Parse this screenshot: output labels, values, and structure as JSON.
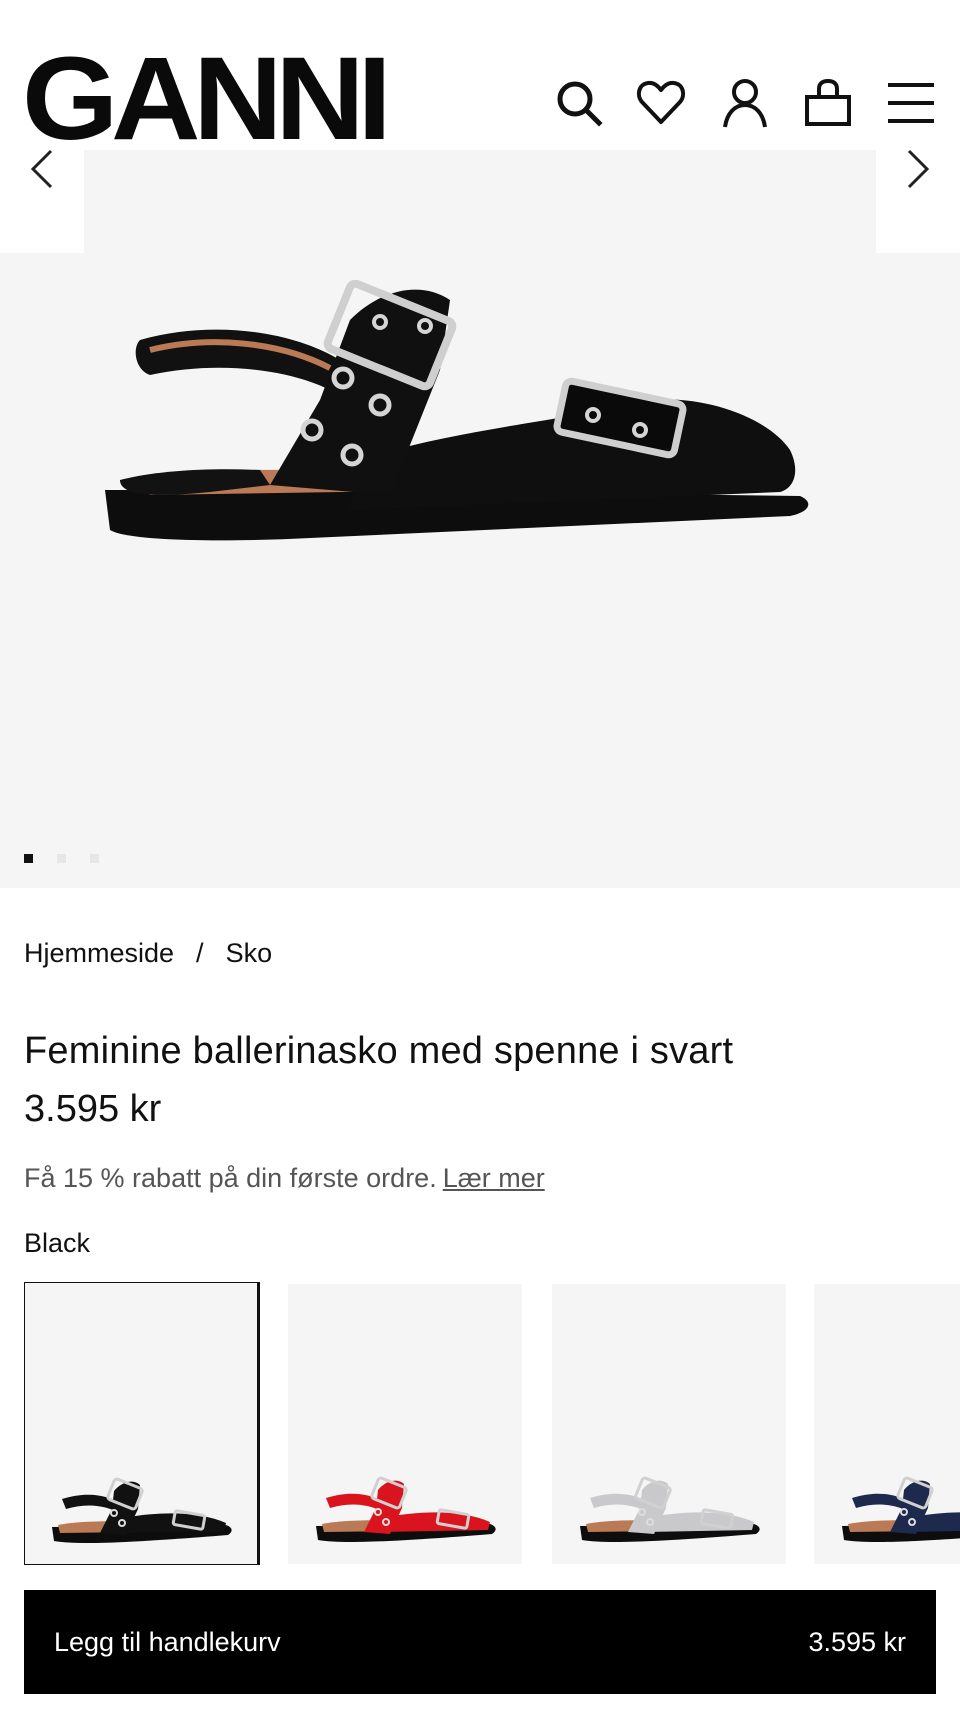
{
  "header": {
    "logo": "GANNI",
    "icons": [
      "search-icon",
      "heart-icon",
      "user-icon",
      "bag-icon",
      "menu-icon"
    ]
  },
  "gallery": {
    "image_count": 3,
    "active_index": 0,
    "shoe_color": "#0d0d0d",
    "lining_color": "#b97a55"
  },
  "breadcrumb": {
    "home": "Hjemmeside",
    "separator": "/",
    "category": "Sko"
  },
  "product": {
    "title": "Feminine ballerinasko med spenne i svart",
    "price": "3.595 kr",
    "promo_text": "Få 15 % rabatt på din første ordre.",
    "promo_link": "Lær mer",
    "color_name": "Black"
  },
  "swatches": [
    {
      "color": "#111111",
      "selected": true
    },
    {
      "color": "#d9141e",
      "selected": false
    },
    {
      "color": "#c9c9cc",
      "selected": false
    },
    {
      "color": "#1d2a4d",
      "selected": false
    }
  ],
  "cart": {
    "label": "Legg til handlekurv",
    "price": "3.595 kr"
  }
}
